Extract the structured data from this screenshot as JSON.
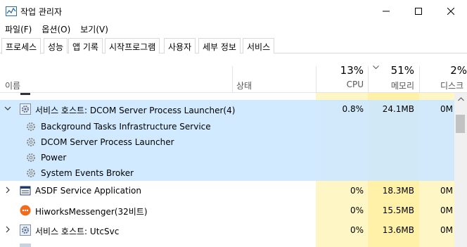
{
  "window": {
    "title": "작업 관리자"
  },
  "menu": [
    "파일(F)",
    "옵션(O)",
    "보기(V)"
  ],
  "tabs": [
    {
      "label": "프로세스",
      "active": true
    },
    {
      "label": "성능"
    },
    {
      "label": "앱 기록"
    },
    {
      "label": "시작프로그램"
    },
    {
      "label": "사용자"
    },
    {
      "label": "세부 정보"
    },
    {
      "label": "서비스"
    }
  ],
  "columns": {
    "name": "이름",
    "status": "상태",
    "cpu": {
      "pct": "13%",
      "label": "CPU"
    },
    "memory": {
      "pct": "51%",
      "label": "메모리"
    },
    "disk": {
      "pct": "2%",
      "label": "디스크"
    }
  },
  "rows": [
    {
      "name": "서비스 호스트: DCOM Server Process Launcher(4)",
      "cpu": "0.8%",
      "memory": "24.1MB",
      "disk": "0M",
      "icon": "gear-icon",
      "expanded": true
    },
    {
      "name": "Background Tasks Infrastructure Service",
      "icon": "gear-icon",
      "child": true
    },
    {
      "name": "DCOM Server Process Launcher",
      "icon": "gear-icon",
      "child": true
    },
    {
      "name": "Power",
      "icon": "gear-icon",
      "child": true
    },
    {
      "name": "System Events Broker",
      "icon": "gear-icon",
      "child": true
    },
    {
      "name": "ASDF Service Application",
      "cpu": "0%",
      "memory": "18.3MB",
      "disk": "0M",
      "icon": "window-icon"
    },
    {
      "name": "HiworksMessenger(32비트)",
      "cpu": "0%",
      "memory": "15.5MB",
      "disk": "0M",
      "icon": "chat-bubble-icon"
    },
    {
      "name": "서비스 호스트: UtcSvc",
      "cpu": "0%",
      "memory": "13.6MB",
      "disk": "0M",
      "icon": "gear-icon"
    }
  ],
  "colors": {
    "selection": "#cce8ff",
    "cpu_col": "#fff6c6",
    "mem_col": "#fff1a8",
    "accent": "#0078d7"
  }
}
